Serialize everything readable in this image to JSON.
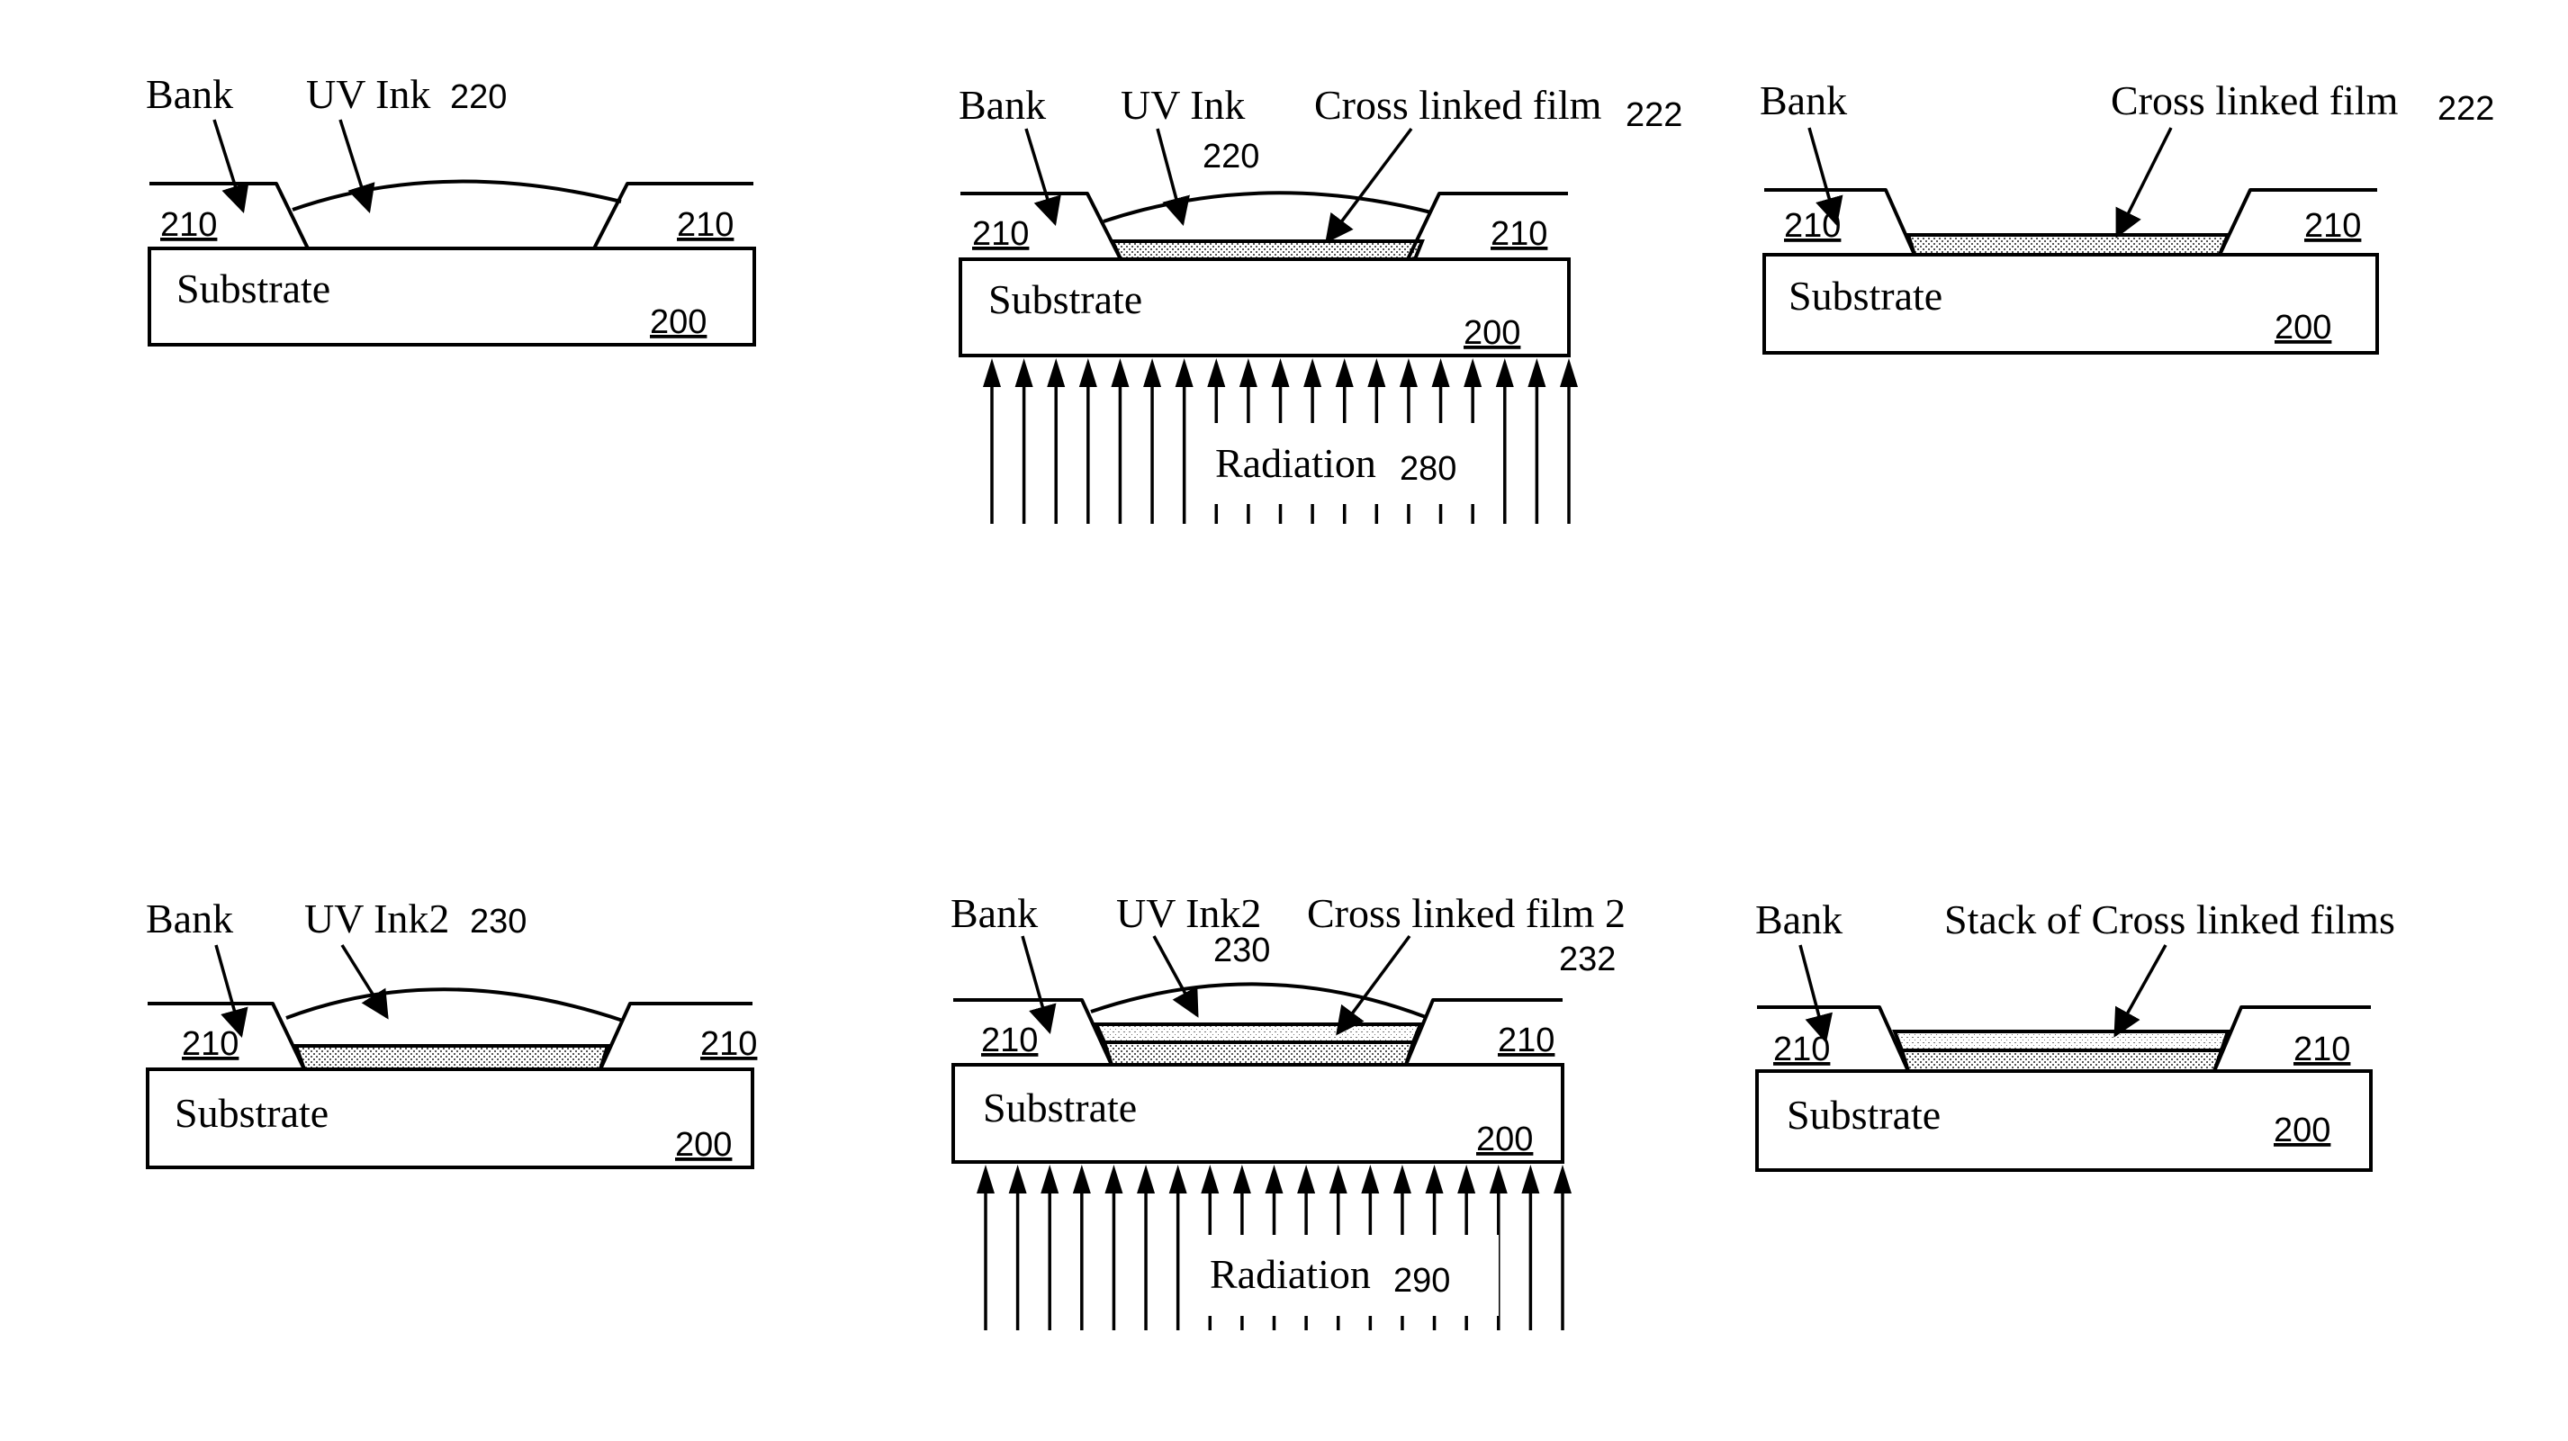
{
  "figure": {
    "panels": [
      {
        "id": "panel-1",
        "labels": {
          "bank": "Bank",
          "ink": "UV Ink",
          "ink_ref": "220"
        },
        "refs": {
          "bank_left": "210",
          "bank_right": "210",
          "substrate": "Substrate",
          "substrate_ref": "200"
        },
        "films": 0,
        "ink_drop": true,
        "radiation": null
      },
      {
        "id": "panel-2",
        "labels": {
          "bank": "Bank",
          "ink": "UV Ink",
          "ink_ref": "220",
          "film": "Cross linked film",
          "film_ref": "222"
        },
        "refs": {
          "bank_left": "210",
          "bank_right": "210",
          "substrate": "Substrate",
          "substrate_ref": "200"
        },
        "films": 1,
        "ink_drop": true,
        "radiation": {
          "label": "Radiation",
          "ref": "280",
          "arrow_count": 19
        }
      },
      {
        "id": "panel-3",
        "labels": {
          "bank": "Bank",
          "film": "Cross linked film",
          "film_ref": "222"
        },
        "refs": {
          "bank_left": "210",
          "bank_right": "210",
          "substrate": "Substrate",
          "substrate_ref": "200"
        },
        "films": 1,
        "ink_drop": false,
        "radiation": null
      },
      {
        "id": "panel-4",
        "labels": {
          "bank": "Bank",
          "ink": "UV Ink2",
          "ink_ref": "230"
        },
        "refs": {
          "bank_left": "210",
          "bank_right": "210",
          "substrate": "Substrate",
          "substrate_ref": "200"
        },
        "films": 1,
        "ink_drop": true,
        "radiation": null
      },
      {
        "id": "panel-5",
        "labels": {
          "bank": "Bank",
          "ink": "UV Ink2",
          "ink_ref": "230",
          "film": "Cross linked film 2",
          "film_ref": "232"
        },
        "refs": {
          "bank_left": "210",
          "bank_right": "210",
          "substrate": "Substrate",
          "substrate_ref": "200"
        },
        "films": 2,
        "ink_drop": true,
        "radiation": {
          "label": "Radiation",
          "ref": "290",
          "arrow_count": 19
        }
      },
      {
        "id": "panel-6",
        "labels": {
          "bank": "Bank",
          "film": "Stack of Cross linked films"
        },
        "refs": {
          "bank_left": "210",
          "bank_right": "210",
          "substrate": "Substrate",
          "substrate_ref": "200"
        },
        "films": 2,
        "ink_drop": false,
        "radiation": null
      }
    ]
  }
}
